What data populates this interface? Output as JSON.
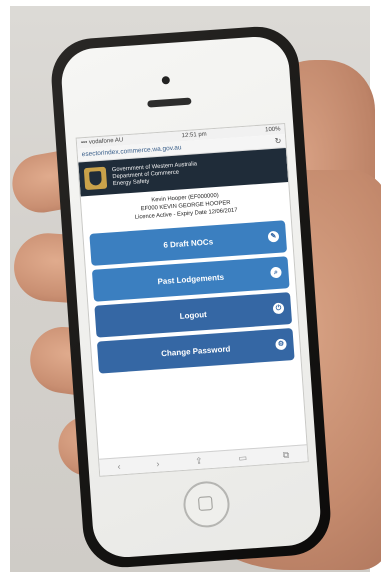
{
  "status_bar": {
    "carrier": "••• vodafone AU",
    "time": "12:51 pm",
    "battery": "100%"
  },
  "browser": {
    "url": "esectorindex.commerce.wa.gov.au"
  },
  "header": {
    "line1": "Government of Western Australia",
    "line2": "Department of Commerce",
    "line3": "Energy Safety"
  },
  "user": {
    "line1": "Kevin Hooper (EF000000)",
    "line2": "EF000 KEVIN GEORGE HOOPER",
    "line3": "Licence Active - Expiry Date 12/06/2017"
  },
  "menu": {
    "draft_label": "6 Draft NOCs",
    "past_label": "Past Lodgements",
    "logout_label": "Logout",
    "change_pw_label": "Change Password"
  },
  "toolbar": {
    "back": "‹",
    "forward": "›",
    "share": "⇪",
    "bookmarks": "▭",
    "tabs": "⧉"
  },
  "colors": {
    "header_bg": "#1f2c39",
    "button_blue": "#3b7fc0",
    "button_dark_blue": "#3567a4"
  }
}
